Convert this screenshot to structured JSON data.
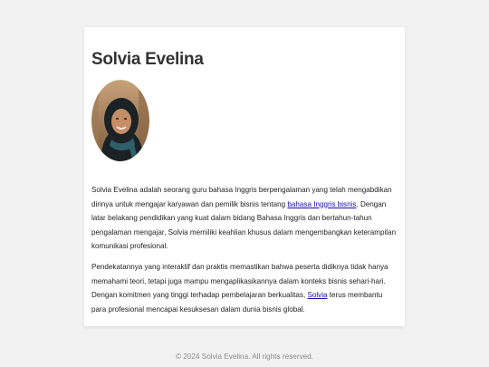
{
  "profile": {
    "name": "Solvia Evelina",
    "avatar": "portrait-photo"
  },
  "bio": {
    "p1_a": "Solvia Evelina adalah seorang guru bahasa Inggris berpengalaman yang telah mengabdikan dirinya untuk mengajar karyawan dan pemilik bisnis tentang ",
    "p1_link": "bahasa Inggris bisnis",
    "p1_b": ". Dengan latar belakang pendidikan yang kuat dalam bidang Bahasa Inggris dan bertahun-tahun pengalaman mengajar, Solvia memiliki keahlian khusus dalam mengembangkan keterampilan komunikasi profesional.",
    "p2_a": "Pendekatannya yang interaktif dan praktis memastikan bahwa peserta didiknya tidak hanya memahami teori, tetapi juga mampu mengaplikasikannya dalam konteks bisnis sehari-hari. Dengan komitmen yang tinggi terhadap pembelajaran berkualitas, ",
    "p2_link": "Solvia",
    "p2_b": " terus membantu para profesional mencapai kesuksesan dalam dunia bisnis global."
  },
  "footer": {
    "copyright": "© 2024 Solvia Evelina. All rights reserved."
  },
  "colors": {
    "background": "#f2f2f2",
    "card": "#ffffff",
    "link": "#1a0dab",
    "footer_text": "#8a8a8a"
  }
}
